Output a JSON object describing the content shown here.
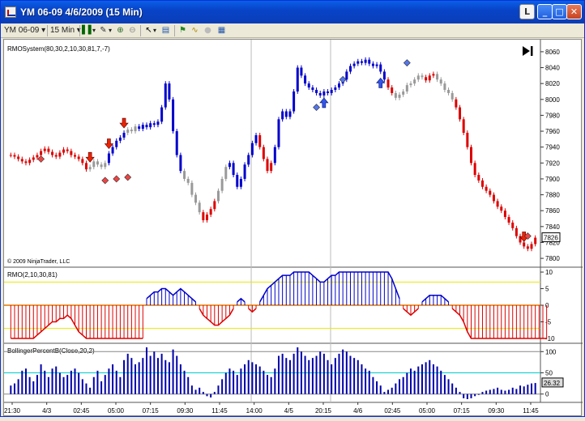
{
  "window": {
    "title": "YM 06-09  4/6/2009 (15 Min)",
    "buttons": {
      "lock": "L",
      "minimize": "_",
      "maximize": "□",
      "close": "✕"
    }
  },
  "toolbar": {
    "instrument": "YM 06-09",
    "interval": "15 Min",
    "icons": [
      "bar-style-icon",
      "draw-tool-icon",
      "zoom-in-icon",
      "zoom-out-icon",
      "pointer-icon",
      "properties-icon",
      "strategy-icon",
      "indicator-icon",
      "circle-icon",
      "data-box-icon"
    ]
  },
  "chart_data": [
    {
      "type": "candlestick",
      "title": "RMOSystem(80,30,2,10,30,81,7,-7)",
      "watermark": "© 2009 NinjaTrader, LLC",
      "yticks": [
        "8060",
        "8040",
        "8020",
        "8000",
        "7980",
        "7960",
        "7940",
        "7920",
        "7900",
        "7880",
        "7860",
        "7840",
        "7820",
        "7800"
      ],
      "ylim": [
        7795,
        8065
      ],
      "last_price": "7826",
      "colors": {
        "up_trend": "#0000cc",
        "down_trend": "#dd0000",
        "neutral": "#999999"
      },
      "closes": [
        7930,
        7928,
        7925,
        7922,
        7920,
        7924,
        7927,
        7930,
        7935,
        7938,
        7934,
        7930,
        7928,
        7933,
        7937,
        7935,
        7930,
        7928,
        7925,
        7920,
        7912,
        7915,
        7922,
        7918,
        7915,
        7920,
        7932,
        7940,
        7948,
        7952,
        7958,
        7962,
        7960,
        7966,
        7963,
        7968,
        7965,
        7970,
        7968,
        7972,
        7990,
        8020,
        8000,
        7960,
        7930,
        7910,
        7900,
        7895,
        7880,
        7870,
        7858,
        7848,
        7855,
        7862,
        7872,
        7885,
        7900,
        7915,
        7920,
        7905,
        7890,
        7900,
        7918,
        7930,
        7945,
        7955,
        7940,
        7925,
        7910,
        7920,
        7940,
        7975,
        7985,
        7978,
        7985,
        8010,
        8040,
        8030,
        8020,
        8015,
        8012,
        8008,
        8005,
        8010,
        8008,
        8012,
        8015,
        8020,
        8025,
        8035,
        8042,
        8045,
        8048,
        8046,
        8050,
        8045,
        8042,
        8044,
        8035,
        8025,
        8015,
        8008,
        8002,
        8006,
        8010,
        8018,
        8020,
        8025,
        8030,
        8028,
        8024,
        8030,
        8032,
        8025,
        8020,
        8012,
        8008,
        8000,
        7990,
        7975,
        7958,
        7940,
        7920,
        7905,
        7898,
        7890,
        7885,
        7880,
        7872,
        7865,
        7860,
        7852,
        7845,
        7838,
        7828,
        7820,
        7815,
        7812,
        7818,
        7826
      ],
      "series_color_pattern": "red:0-39 grey:21-26,31-33 blue:26-46 grey:46-51 red:51-55 grey:55-58 blue:58-66 red:66-70 blue:70-102 grey:102-110 red:100-113 grey:113-118 red:118-140",
      "signals": [
        {
          "kind": "arrow-down",
          "bar": 21
        },
        {
          "kind": "arrow-down",
          "bar": 26
        },
        {
          "kind": "arrow-down",
          "bar": 30
        },
        {
          "kind": "arrow-up",
          "bar": 83
        },
        {
          "kind": "arrow-up",
          "bar": 98
        },
        {
          "kind": "arrow-down",
          "bar": 136
        }
      ],
      "diamonds": [
        {
          "color": "red",
          "bar": 8,
          "value": 7925
        },
        {
          "color": "red",
          "bar": 25,
          "value": 7898
        },
        {
          "color": "red",
          "bar": 28,
          "value": 7900
        },
        {
          "color": "red",
          "bar": 31,
          "value": 7902
        },
        {
          "color": "blue",
          "bar": 81,
          "value": 7990
        },
        {
          "color": "blue",
          "bar": 88,
          "value": 8025
        },
        {
          "color": "blue",
          "bar": 105,
          "value": 8046
        },
        {
          "color": "red",
          "bar": 137,
          "value": 7828
        }
      ]
    },
    {
      "type": "bar",
      "title": "RMO(2,10,30,81)",
      "yticks": [
        "10",
        "5",
        "0",
        "-5",
        "-10"
      ],
      "ylim": [
        -10.5,
        10.5
      ],
      "levels": [
        7,
        -7
      ],
      "level_color": "#e8e800",
      "zero_color": "#e07800",
      "values": [
        -10,
        -10,
        -10,
        -10,
        -10,
        -10,
        -10,
        -9,
        -8,
        -7,
        -6,
        -5,
        -5,
        -4,
        -4,
        -3,
        -4,
        -6,
        -8,
        -9,
        -10,
        -10,
        -10,
        -10,
        -10,
        -10,
        -10,
        -10,
        -10,
        -10,
        -10,
        -10,
        -10,
        -10,
        -10,
        -10,
        2,
        3,
        4,
        4,
        5,
        5,
        4,
        3,
        4,
        5,
        4,
        3,
        2,
        1,
        -1,
        -3,
        -4,
        -5,
        -6,
        -6,
        -5,
        -4,
        -3,
        -1,
        1,
        2,
        1,
        -1,
        -2,
        -1,
        1,
        3,
        5,
        6,
        7,
        8,
        9,
        9,
        9,
        10,
        10,
        10,
        10,
        10,
        9,
        8,
        7,
        7,
        8,
        9,
        9,
        10,
        10,
        10,
        10,
        10,
        10,
        10,
        10,
        10,
        10,
        10,
        10,
        10,
        10,
        8,
        5,
        2,
        -1,
        -2,
        -3,
        -2,
        -1,
        1,
        2,
        3,
        3,
        3,
        3,
        2,
        1,
        -1,
        -2,
        -3,
        -5,
        -8,
        -10,
        -10,
        -10,
        -10,
        -10,
        -10,
        -10,
        -10,
        -10,
        -10,
        -10,
        -10,
        -10,
        -10,
        -10,
        -10,
        -10,
        -10,
        -10,
        -10,
        -10
      ],
      "up_color": "#0000cc",
      "down_color": "#dd0000"
    },
    {
      "type": "bar",
      "title": "BollingerPercentB(Close,20,2)",
      "yticks": [
        "100",
        "50",
        "0"
      ],
      "ylim": [
        -12,
        112
      ],
      "last_value": "26.32",
      "reference_color": "#00cccc",
      "bar_color": "#0000aa",
      "values": [
        20,
        25,
        35,
        55,
        60,
        40,
        30,
        45,
        70,
        55,
        40,
        60,
        65,
        50,
        40,
        45,
        55,
        60,
        50,
        35,
        25,
        15,
        40,
        55,
        30,
        45,
        60,
        70,
        55,
        40,
        80,
        95,
        85,
        70,
        75,
        85,
        110,
        90,
        100,
        85,
        95,
        80,
        75,
        105,
        90,
        70,
        55,
        40,
        20,
        10,
        15,
        5,
        -5,
        -8,
        5,
        20,
        35,
        50,
        60,
        55,
        45,
        60,
        70,
        80,
        75,
        70,
        65,
        55,
        45,
        40,
        60,
        90,
        95,
        85,
        80,
        95,
        110,
        100,
        90,
        80,
        85,
        90,
        100,
        95,
        80,
        70,
        85,
        95,
        105,
        100,
        90,
        85,
        80,
        70,
        60,
        55,
        40,
        30,
        20,
        5,
        10,
        15,
        25,
        35,
        40,
        50,
        60,
        55,
        65,
        70,
        75,
        80,
        70,
        65,
        55,
        45,
        35,
        25,
        15,
        5,
        -10,
        -12,
        -10,
        -5,
        0,
        5,
        8,
        10,
        12,
        15,
        10,
        8,
        10,
        15,
        12,
        20,
        18,
        22,
        25,
        26
      ]
    }
  ],
  "x_axis": {
    "labels": [
      "21:30",
      "4/3",
      "02:45",
      "05:00",
      "07:15",
      "09:30",
      "11:45",
      "14:00",
      "4/5",
      "20:15",
      "4/6",
      "02:45",
      "05:00",
      "07:15",
      "09:30",
      "11:45"
    ]
  }
}
